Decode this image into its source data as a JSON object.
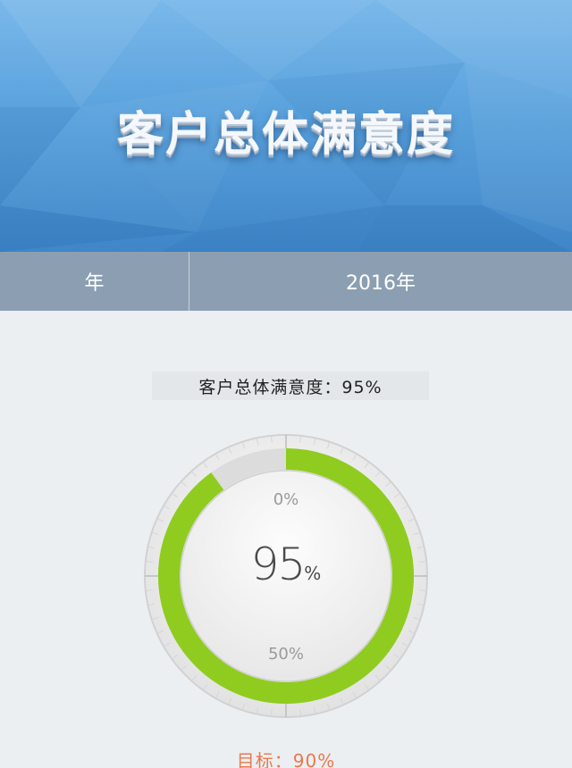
{
  "header": {
    "title": "客户总体满意度"
  },
  "filter": {
    "year_label": "年",
    "year_value": "2016年"
  },
  "metric": {
    "heading": "客户总体满意度：95%"
  },
  "gauge": {
    "value": 95,
    "value_text": "95",
    "unit": "%",
    "progress_fraction": 0.9,
    "tick_top": "0%",
    "tick_bottom": "50%",
    "colors": {
      "progress": "#8fcc1f",
      "track": "#dcdcdc"
    }
  },
  "target": {
    "text": "目标：90%"
  }
}
